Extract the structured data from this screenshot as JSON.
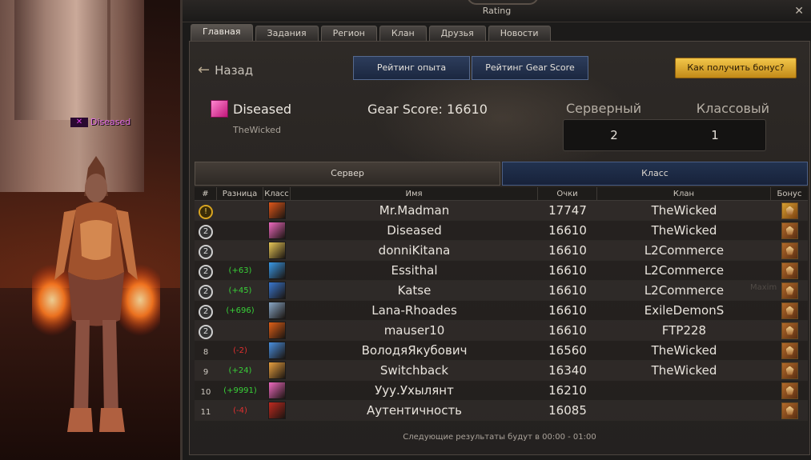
{
  "scene": {
    "nameplate_name": "Diseased",
    "nameplate_icon": "class-cross-icon"
  },
  "window": {
    "title": "Rating",
    "close_glyph": "✕",
    "tabs": [
      {
        "label": "Главная",
        "active": true
      },
      {
        "label": "Задания",
        "active": false
      },
      {
        "label": "Регион",
        "active": false
      },
      {
        "label": "Клан",
        "active": false
      },
      {
        "label": "Друзья",
        "active": false
      },
      {
        "label": "Новости",
        "active": false
      }
    ]
  },
  "toolbar": {
    "back_label": "Назад",
    "back_icon": "back-arrow-icon",
    "exp_rating_label": "Рейтинг опыта",
    "gear_rating_label": "Рейтинг Gear Score",
    "bonus_label": "Как получить бонус?"
  },
  "player": {
    "name": "Diseased",
    "clan": "TheWicked",
    "gear_score_label": "Gear Score: 16610",
    "server_rank_label": "Серверный",
    "class_rank_label": "Классовый",
    "server_rank": "2",
    "class_rank": "1"
  },
  "segments": {
    "server": "Сервер",
    "class": "Класс",
    "active": "class"
  },
  "table": {
    "headers": [
      "#",
      "Разница",
      "Класс",
      "Имя",
      "Очки",
      "Клан",
      "Бонус"
    ],
    "rows": [
      {
        "rank": "1",
        "medal": "gold",
        "delta": "",
        "delta_color": "",
        "class_color": "#e0571a",
        "name": "Mr.Madman",
        "score": "17747",
        "clan": "TheWicked",
        "bonus": "gold-crown-icon"
      },
      {
        "rank": "2",
        "medal": "silver",
        "delta": "",
        "delta_color": "",
        "class_color": "#f06ac0",
        "name": "Diseased",
        "score": "16610",
        "clan": "TheWicked",
        "bonus": "bronze-bonus-icon"
      },
      {
        "rank": "2",
        "medal": "silver",
        "delta": "",
        "delta_color": "",
        "class_color": "#e8c858",
        "name": "donniKitana",
        "score": "16610",
        "clan": "L2Commerce",
        "bonus": "bronze-bonus-icon"
      },
      {
        "rank": "2",
        "medal": "silver",
        "delta": "(+63)",
        "delta_color": "#38d038",
        "class_color": "#3a9ae8",
        "name": "Essithal",
        "score": "16610",
        "clan": "L2Commerce",
        "bonus": "bronze-bonus-icon"
      },
      {
        "rank": "2",
        "medal": "silver",
        "delta": "(+45)",
        "delta_color": "#38d038",
        "class_color": "#3a78d0",
        "name": "Katse",
        "score": "16610",
        "clan": "L2Commerce",
        "bonus": "bronze-bonus-icon"
      },
      {
        "rank": "2",
        "medal": "silver",
        "delta": "(+696)",
        "delta_color": "#38d038",
        "class_color": "#8aa8c8",
        "name": "Lana-Rhoades",
        "score": "16610",
        "clan": "ExileDemonS",
        "bonus": "bronze-bonus-icon"
      },
      {
        "rank": "2",
        "medal": "silver",
        "delta": "",
        "delta_color": "",
        "class_color": "#e06018",
        "name": "mauser10",
        "score": "16610",
        "clan": "FTP228",
        "bonus": "bronze-bonus-icon"
      },
      {
        "rank": "8",
        "medal": "",
        "delta": "(-2)",
        "delta_color": "#e03030",
        "class_color": "#4a90e0",
        "name": "ВолодяЯкубович",
        "score": "16560",
        "clan": "TheWicked",
        "bonus": "bronze-bonus-icon"
      },
      {
        "rank": "9",
        "medal": "",
        "delta": "(+24)",
        "delta_color": "#38d038",
        "class_color": "#e8a040",
        "name": "Switchback",
        "score": "16340",
        "clan": "TheWicked",
        "bonus": "bronze-bonus-icon"
      },
      {
        "rank": "10",
        "medal": "",
        "delta": "(+9991)",
        "delta_color": "#38d038",
        "class_color": "#f06ac0",
        "name": "Ууу.Ухылянт",
        "score": "16210",
        "clan": "",
        "bonus": "bronze-bonus-icon"
      },
      {
        "rank": "11",
        "medal": "",
        "delta": "(-4)",
        "delta_color": "#e03030",
        "class_color": "#c02a20",
        "name": "Аутентичность",
        "score": "16085",
        "clan": "",
        "bonus": "bronze-bonus-icon"
      }
    ]
  },
  "footer": {
    "next_results": "Следующие результаты будут в 00:00 - 01:00"
  },
  "watermark": "Maxim"
}
